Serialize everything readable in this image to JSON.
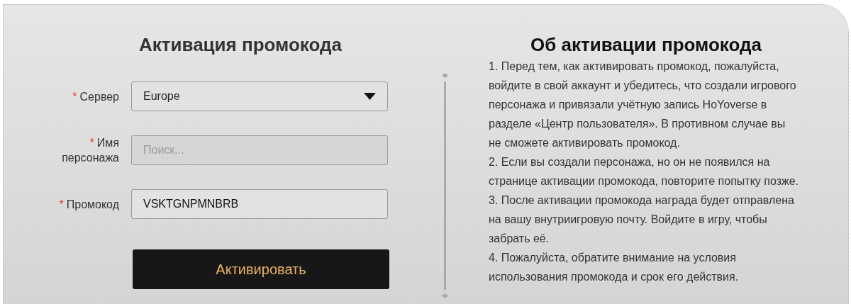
{
  "form": {
    "title": "Активация промокода",
    "fields": [
      {
        "kind": "select",
        "required_mark": "*",
        "label": "Сервер",
        "value": "Europe",
        "disabled": false
      },
      {
        "kind": "input",
        "required_mark": "*",
        "label": "Имя персонажа",
        "placeholder": "Поиск...",
        "disabled": true
      },
      {
        "kind": "input",
        "required_mark": "*",
        "label": "Промокод",
        "value": "VSKTGNPMNBRB",
        "disabled": false
      }
    ],
    "submit": "Активировать"
  },
  "info": {
    "title": "Об активации промокода",
    "items": [
      "1. Перед тем, как активировать промокод, пожалуйста, войдите в свой аккаунт и убедитесь, что создали игрового персонажа и привязали учётную запись HoYoverse в разделе «Центр пользователя». В противном случае вы не сможете активировать промокод.",
      "2. Если вы создали персонажа, но он не появился на странице активации промокода, повторите попытку позже.",
      "3. После активации промокода награда будет отправлена на вашу внутриигровую почту. Войдите в игру, чтобы забрать её.",
      "4. Пожалуйста, обратите внимание на условия использования промокода и срок его действия."
    ]
  }
}
